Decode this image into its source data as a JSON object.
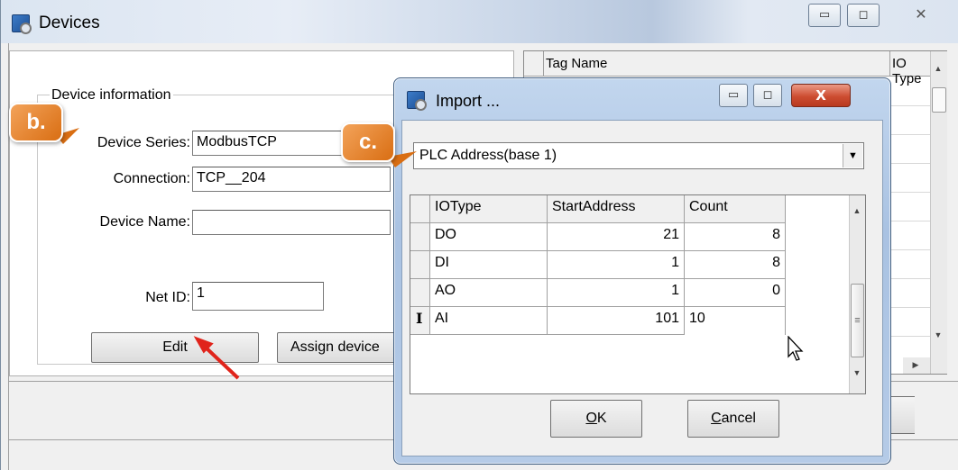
{
  "devices_window": {
    "title": "Devices",
    "icon": "devices-app-icon",
    "caption_buttons": {
      "minimize": "▭",
      "maximize": "◻",
      "close": "✕"
    },
    "group_label": "Device information",
    "fields": {
      "device_series": {
        "label": "Device Series:",
        "value": "ModbusTCP"
      },
      "connection": {
        "label": "Connection:",
        "value": "TCP__204"
      },
      "device_name": {
        "label": "Device Name:",
        "value": ""
      },
      "net_id": {
        "label": "Net ID:",
        "value": "1"
      }
    },
    "buttons": {
      "edit": "Edit",
      "assign": "Assign device"
    },
    "tag_grid": {
      "columns": [
        "Tag Name",
        "IO Type"
      ]
    }
  },
  "import_dialog": {
    "title": "Import ...",
    "icon": "import-app-icon",
    "caption_buttons": {
      "minimize": "▭",
      "maximize": "◻",
      "close": "X"
    },
    "address_mode": "PLC Address(base 1)",
    "columns": [
      "IOType",
      "StartAddress",
      "Count"
    ],
    "rows": [
      {
        "type": "DO",
        "start": "21",
        "count": "8"
      },
      {
        "type": "DI",
        "start": "1",
        "count": "8"
      },
      {
        "type": "AO",
        "start": "1",
        "count": "0"
      },
      {
        "type": "AI",
        "start": "101",
        "count": "10"
      }
    ],
    "edit_row_marker": "I",
    "ok_parts": {
      "accel": "O",
      "rest": "K"
    },
    "cancel_parts": {
      "accel": "C",
      "rest": "ancel"
    }
  },
  "annotations": {
    "b": "b.",
    "c": "c."
  },
  "colors": {
    "badge": "#e8862f",
    "arrow": "#e0241b",
    "close_button": "#cd4d31"
  }
}
